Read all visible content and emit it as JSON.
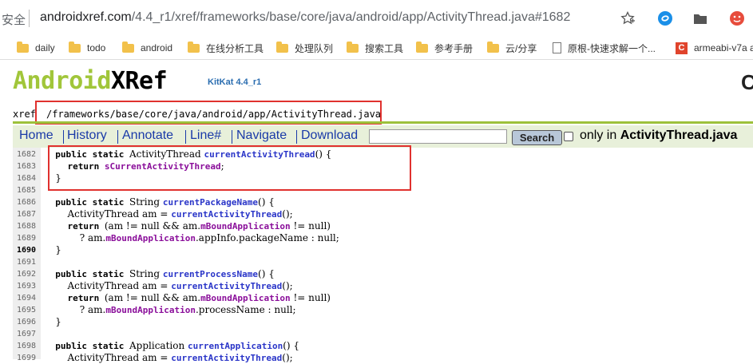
{
  "browser": {
    "security_prefix": "安全",
    "url_host": "androidxref.com",
    "url_path": "/4.4_r1/xref/frameworks/base/core/java/android/app/ActivityThread.java#1682",
    "icons": [
      "add-bookmark-icon",
      "sync-icon",
      "folder-icon",
      "profile-icon"
    ]
  },
  "bookmarks": [
    {
      "label": "daily",
      "icon": "folder-icon"
    },
    {
      "label": "todo",
      "icon": "folder-icon"
    },
    {
      "label": "android",
      "icon": "folder-icon"
    },
    {
      "label": "在线分析工具",
      "icon": "folder-icon"
    },
    {
      "label": "处理队列",
      "icon": "folder-icon"
    },
    {
      "label": "搜索工具",
      "icon": "folder-icon"
    },
    {
      "label": "参考手册",
      "icon": "folder-icon"
    },
    {
      "label": "云/分享",
      "icon": "folder-icon"
    },
    {
      "label": "原根-快速求解一个...",
      "icon": "page-icon"
    },
    {
      "label": "armeabi-v7a a",
      "icon": "c-icon"
    }
  ],
  "header": {
    "logo_android": "Android",
    "logo_xref": "XRef",
    "version": "KitKat 4.4_r1",
    "right_letter": "C",
    "xref_label": "xref",
    "path": "/frameworks/base/core/java/android/app/ActivityThread.java"
  },
  "menu": {
    "items": [
      "Home",
      "History",
      "Annotate",
      "Line#",
      "Navigate",
      "Download"
    ],
    "search_value": "",
    "search_label": "Search",
    "only_in_label": "only in",
    "only_in_file": "ActivityThread.java"
  },
  "colors": {
    "accent_green": "#9dc13b",
    "link_blue": "#1a3aa8",
    "highlight_red": "#e0312e",
    "field_purple": "#8a0e9a"
  },
  "code": {
    "current_line": "1690",
    "lines": [
      {
        "n": "1682",
        "parts": [
          [
            "",
            "    "
          ],
          [
            "kw",
            "public static "
          ],
          [
            "ty",
            "ActivityThread "
          ],
          [
            "fn",
            "currentActivityThread"
          ],
          [
            "",
            "() {"
          ]
        ]
      },
      {
        "n": "1683",
        "parts": [
          [
            "",
            "        "
          ],
          [
            "kw",
            "return "
          ],
          [
            "fld",
            "sCurrentActivityThread"
          ],
          [
            "",
            ";"
          ]
        ]
      },
      {
        "n": "1684",
        "parts": [
          [
            "",
            "    }"
          ]
        ]
      },
      {
        "n": "1685",
        "parts": []
      },
      {
        "n": "1686",
        "parts": [
          [
            "",
            "    "
          ],
          [
            "kw",
            "public static "
          ],
          [
            "ty",
            "String "
          ],
          [
            "fn",
            "currentPackageName"
          ],
          [
            "",
            "() {"
          ]
        ]
      },
      {
        "n": "1687",
        "parts": [
          [
            "",
            "        "
          ],
          [
            "ty",
            "ActivityThread am = "
          ],
          [
            "fn",
            "currentActivityThread"
          ],
          [
            "",
            "();"
          ]
        ]
      },
      {
        "n": "1688",
        "parts": [
          [
            "",
            "        "
          ],
          [
            "kw",
            "return "
          ],
          [
            "",
            "(am != null && am."
          ],
          [
            "fld",
            "mBoundApplication"
          ],
          [
            "",
            " != null)"
          ]
        ]
      },
      {
        "n": "1689",
        "parts": [
          [
            "",
            "            ? am."
          ],
          [
            "fld",
            "mBoundApplication"
          ],
          [
            "",
            ".appInfo.packageName : null;"
          ]
        ]
      },
      {
        "n": "1690",
        "parts": [
          [
            "",
            "    }"
          ]
        ]
      },
      {
        "n": "1691",
        "parts": []
      },
      {
        "n": "1692",
        "parts": [
          [
            "",
            "    "
          ],
          [
            "kw",
            "public static "
          ],
          [
            "ty",
            "String "
          ],
          [
            "fn",
            "currentProcessName"
          ],
          [
            "",
            "() {"
          ]
        ]
      },
      {
        "n": "1693",
        "parts": [
          [
            "",
            "        "
          ],
          [
            "ty",
            "ActivityThread am = "
          ],
          [
            "fn",
            "currentActivityThread"
          ],
          [
            "",
            "();"
          ]
        ]
      },
      {
        "n": "1694",
        "parts": [
          [
            "",
            "        "
          ],
          [
            "kw",
            "return "
          ],
          [
            "",
            "(am != null && am."
          ],
          [
            "fld",
            "mBoundApplication"
          ],
          [
            "",
            " != null)"
          ]
        ]
      },
      {
        "n": "1695",
        "parts": [
          [
            "",
            "            ? am."
          ],
          [
            "fld",
            "mBoundApplication"
          ],
          [
            "",
            ".processName : null;"
          ]
        ]
      },
      {
        "n": "1696",
        "parts": [
          [
            "",
            "    }"
          ]
        ]
      },
      {
        "n": "1697",
        "parts": []
      },
      {
        "n": "1698",
        "parts": [
          [
            "",
            "    "
          ],
          [
            "kw",
            "public static "
          ],
          [
            "ty",
            "Application "
          ],
          [
            "fn",
            "currentApplication"
          ],
          [
            "",
            "() {"
          ]
        ]
      },
      {
        "n": "1699",
        "parts": [
          [
            "",
            "        "
          ],
          [
            "ty",
            "ActivityThread am = "
          ],
          [
            "fn",
            "currentActivityThread"
          ],
          [
            "",
            "();"
          ]
        ]
      }
    ]
  }
}
